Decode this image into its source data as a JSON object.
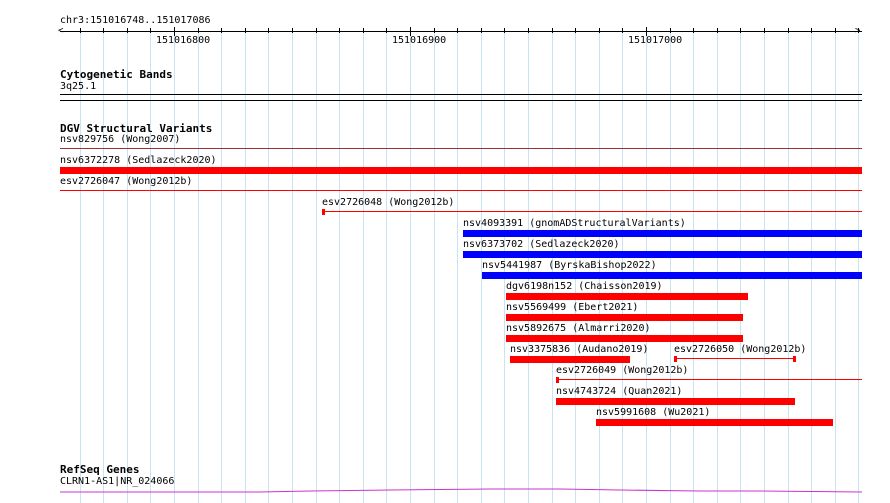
{
  "ruler": {
    "locus": "chr3:151016748..151017086",
    "ticks": [
      "151016800",
      "151016900",
      "151017000"
    ]
  },
  "tracks": {
    "cytobands": {
      "title": "Cytogenetic Bands",
      "band": "3q25.1"
    },
    "dgv": {
      "title": "DGV Structural Variants",
      "features": [
        {
          "label": "nsv829756 (Wong2007)",
          "color": "#993333",
          "style": "thin"
        },
        {
          "label": "nsv6372278 (Sedlazeck2020)",
          "color": "#ff0000",
          "style": "thick"
        },
        {
          "label": "esv2726047 (Wong2012b)",
          "color": "#ff0000",
          "style": "thin"
        },
        {
          "label": "esv2726048 (Wong2012b)",
          "color": "#ff0000",
          "style": "thin-cap"
        },
        {
          "label": "nsv4093391 (gnomADStructuralVariants)",
          "color": "#0000ff",
          "style": "thick"
        },
        {
          "label": "nsv6373702 (Sedlazeck2020)",
          "color": "#0000ff",
          "style": "thick"
        },
        {
          "label": "nsv5441987 (ByrskaBishop2022)",
          "color": "#0000ff",
          "style": "thick"
        },
        {
          "label": "dgv6198n152 (Chaisson2019)",
          "color": "#ff0000",
          "style": "thick"
        },
        {
          "label": "nsv5569499 (Ebert2021)",
          "color": "#ff0000",
          "style": "thick"
        },
        {
          "label": "nsv5892675 (Almarri2020)",
          "color": "#ff0000",
          "style": "thick"
        },
        {
          "label": "nsv3375836 (Audano2019)",
          "color": "#ff0000",
          "style": "thick"
        },
        {
          "label": "esv2726050 (Wong2012b)",
          "color": "#ff0000",
          "style": "thin-cap"
        },
        {
          "label": "esv2726049 (Wong2012b)",
          "color": "#ff0000",
          "style": "thin-cap"
        },
        {
          "label": "nsv4743724 (Quan2021)",
          "color": "#ff0000",
          "style": "thick"
        },
        {
          "label": "nsv5991608 (Wu2021)",
          "color": "#ff0000",
          "style": "thick"
        }
      ]
    },
    "refseq": {
      "title": "RefSeq Genes",
      "gene": "CLRN1-AS1|NR_024066",
      "color": "#cc33cc"
    }
  }
}
